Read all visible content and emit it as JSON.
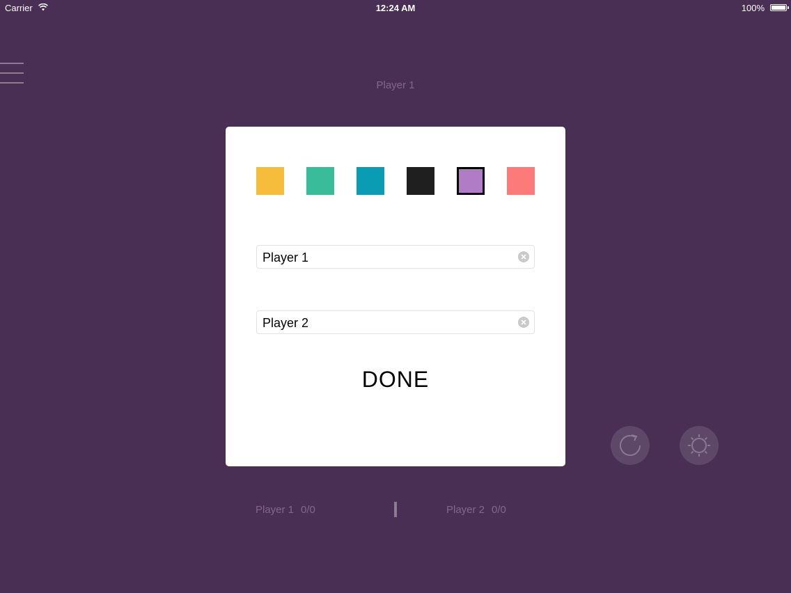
{
  "status_bar": {
    "carrier": "Carrier",
    "time": "12:24 AM",
    "battery": "100%"
  },
  "background": {
    "title": "Player 1",
    "scoreboard": {
      "player1_name": "Player 1",
      "player1_score": "0/0",
      "player2_name": "Player 2",
      "player2_score": "0/0"
    },
    "buttons": {
      "menu_icon": "menu-icon",
      "refresh_icon": "refresh-icon",
      "settings_icon": "settings-icon"
    }
  },
  "dialog": {
    "color_swatches": [
      {
        "color": "#f6bd3c",
        "selected": false
      },
      {
        "color": "#38bc9a",
        "selected": false
      },
      {
        "color": "#0a9cb3",
        "selected": false
      },
      {
        "color": "#1f1f1f",
        "selected": false
      },
      {
        "color": "#b07cc6",
        "selected": true
      },
      {
        "color": "#fc7a7a",
        "selected": false
      }
    ],
    "player1_field": {
      "value": "Player 1"
    },
    "player2_field": {
      "value": "Player 2"
    },
    "done_label": "DONE"
  }
}
